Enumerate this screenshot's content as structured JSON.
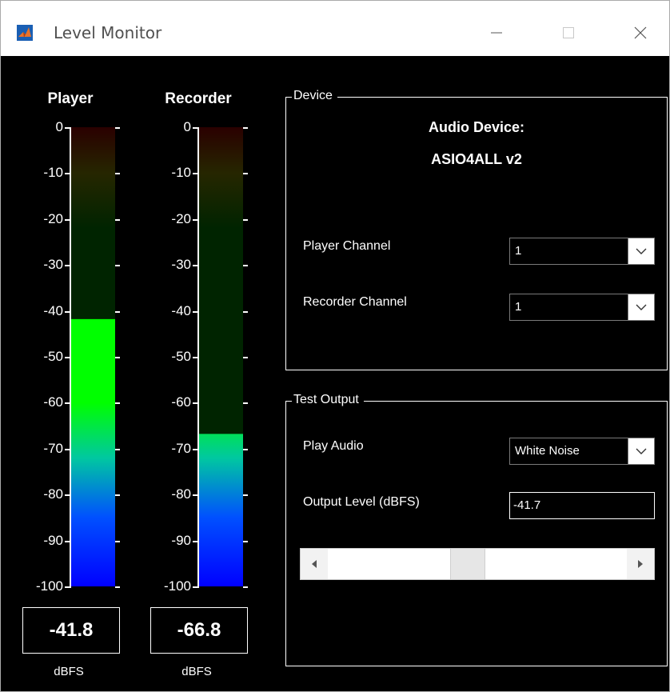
{
  "window": {
    "title": "Level Monitor",
    "controls": {
      "minimize": "minimize-icon",
      "maximize": "maximize-icon",
      "close": "close-icon"
    }
  },
  "meters": {
    "scale": [
      "0",
      "-10",
      "-20",
      "-30",
      "-40",
      "-50",
      "-60",
      "-70",
      "-80",
      "-90",
      "-100"
    ],
    "player": {
      "title": "Player",
      "readout": "-41.8",
      "unit": "dBFS",
      "level_dbfs": -41.8
    },
    "recorder": {
      "title": "Recorder",
      "readout": "-66.8",
      "unit": "dBFS",
      "level_dbfs": -66.8
    }
  },
  "device": {
    "title": "Device",
    "heading": "Audio Device:",
    "name": "ASIO4ALL v2",
    "player_channel": {
      "label": "Player Channel",
      "value": "1"
    },
    "recorder_channel": {
      "label": "Recorder Channel",
      "value": "1"
    }
  },
  "test_output": {
    "title": "Test Output",
    "play_audio": {
      "label": "Play Audio",
      "value": "White Noise"
    },
    "output_level": {
      "label": "Output Level (dBFS)",
      "value": "-41.7"
    },
    "slider_fraction": 0.46
  },
  "colors": {
    "background": "#000000",
    "text": "#ffffff",
    "meter_green": "#00ff00",
    "meter_blue": "#0000ff"
  }
}
